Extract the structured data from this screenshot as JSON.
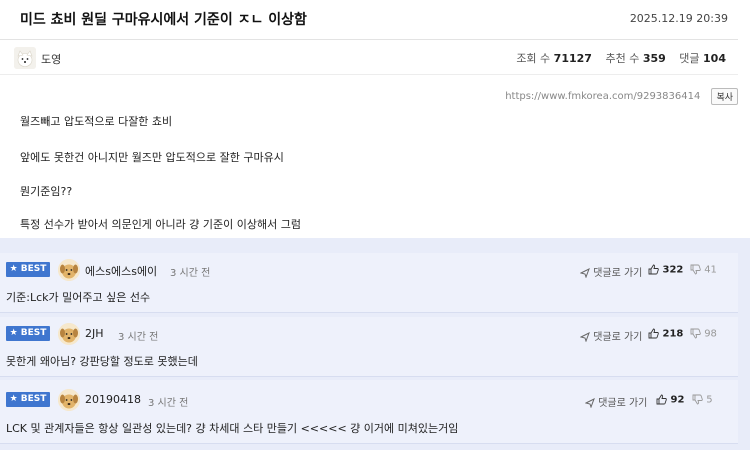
{
  "post": {
    "title": "미드 쵸비 원딜 구마유시에서 기준이 ㅈㄴ 이상함",
    "date": "2025.12.19 20:39",
    "author": "도영",
    "stats": {
      "views_label": "조회 수",
      "views": "71127",
      "recommend_label": "추천 수",
      "recommend": "359",
      "comments_label": "댓글",
      "comments": "104"
    },
    "url": "https://www.fmkorea.com/9293836414",
    "copy_label": "복사",
    "body": [
      "월즈빼고 압도적으로 다잘한 쵸비",
      "앞에도 못한건 아니지만 월즈만 압도적으로 잘한 구마유시",
      "뭔기준임??",
      "특정 선수가 받아서 의문인게 아니라 걍 기준이 이상해서 그럼"
    ]
  },
  "comments": [
    {
      "badge": "★ BEST",
      "author": "에스s에스s에이",
      "time": "3 시간 전",
      "reply": "댓글로 가기",
      "up": "322",
      "down": "41",
      "text": "기준:Lck가 밀어주고 싶은 선수"
    },
    {
      "badge": "★ BEST",
      "author": "2JH",
      "time": "3 시간 전",
      "reply": "댓글로 가기",
      "up": "218",
      "down": "98",
      "text": "못한게 왜아님? 강판당할 정도로 못했는데"
    },
    {
      "badge": "★ BEST",
      "author": "20190418",
      "time": "3 시간 전",
      "reply": "댓글로 가기",
      "up": "92",
      "down": "5",
      "text": "LCK 및 관계자들은 항상 일관성 있는데? 걍 차세대 스타 만들기 <<<<< 걍 이거에 미쳐있는거임"
    }
  ],
  "icons": {
    "reply": "reply-arrow-icon",
    "up": "thumbs-up-icon",
    "down": "thumbs-down-icon"
  },
  "colors": {
    "best_badge": "#3f76cf",
    "comment_bg": "#eef1fb"
  }
}
